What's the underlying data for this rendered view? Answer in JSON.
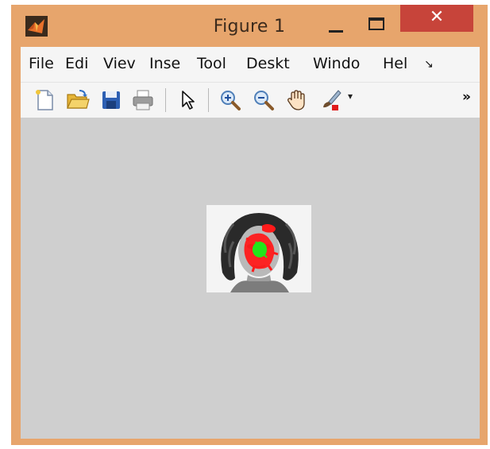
{
  "window": {
    "title": "Figure 1",
    "close_glyph": "✕"
  },
  "menu": {
    "items": [
      "File",
      "Edi",
      "Viev",
      "Inse",
      "Tool",
      "Deskt",
      "Windo",
      "Hel"
    ],
    "more_glyph": "↘"
  },
  "toolbar": {
    "buttons": [
      "new-figure-icon",
      "open-folder-icon",
      "save-icon",
      "print-icon",
      "select-pointer-icon",
      "zoom-in-icon",
      "zoom-out-icon",
      "pan-hand-icon",
      "brush-icon"
    ],
    "more_glyph": "»",
    "dropdown_glyph": "▾"
  },
  "figure": {
    "image": "grayscale face photo with red and green segmentation overlay",
    "overlay_colors": {
      "region_outer": "#ff1a1a",
      "region_inner": "#22e61a"
    }
  }
}
